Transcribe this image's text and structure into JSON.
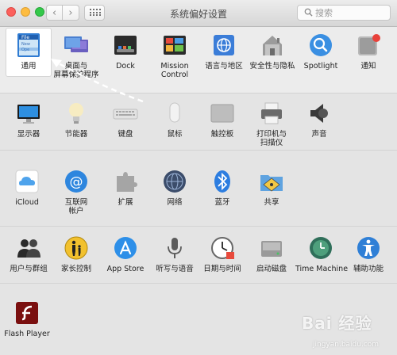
{
  "window": {
    "title": "系统偏好设置",
    "search_placeholder": "搜索"
  },
  "rows": [
    {
      "items": [
        {
          "label": "通用",
          "icon": "general-icon",
          "selected": true
        },
        {
          "label": "桌面与\n屏幕保护程序",
          "icon": "desktop-screensaver-icon"
        },
        {
          "label": "Dock",
          "icon": "dock-icon"
        },
        {
          "label": "Mission\nControl",
          "icon": "mission-control-icon"
        },
        {
          "label": "语言与地区",
          "icon": "language-region-icon"
        },
        {
          "label": "安全性与隐私",
          "icon": "security-privacy-icon"
        },
        {
          "label": "Spotlight",
          "icon": "spotlight-icon"
        },
        {
          "label": "通知",
          "icon": "notifications-icon"
        }
      ]
    },
    {
      "items": [
        {
          "label": "显示器",
          "icon": "displays-icon"
        },
        {
          "label": "节能器",
          "icon": "energy-saver-icon"
        },
        {
          "label": "键盘",
          "icon": "keyboard-icon"
        },
        {
          "label": "鼠标",
          "icon": "mouse-icon"
        },
        {
          "label": "触控板",
          "icon": "trackpad-icon"
        },
        {
          "label": "打印机与\n扫描仪",
          "icon": "printers-scanners-icon"
        },
        {
          "label": "声音",
          "icon": "sound-icon"
        }
      ]
    },
    {
      "items": [
        {
          "label": "iCloud",
          "icon": "icloud-icon"
        },
        {
          "label": "互联网\n帐户",
          "icon": "internet-accounts-icon"
        },
        {
          "label": "扩展",
          "icon": "extensions-icon"
        },
        {
          "label": "网络",
          "icon": "network-icon"
        },
        {
          "label": "蓝牙",
          "icon": "bluetooth-icon"
        },
        {
          "label": "共享",
          "icon": "sharing-icon"
        }
      ]
    },
    {
      "items": [
        {
          "label": "用户与群组",
          "icon": "users-groups-icon"
        },
        {
          "label": "家长控制",
          "icon": "parental-controls-icon"
        },
        {
          "label": "App Store",
          "icon": "app-store-icon"
        },
        {
          "label": "听写与语音",
          "icon": "dictation-speech-icon"
        },
        {
          "label": "日期与时间",
          "icon": "date-time-icon"
        },
        {
          "label": "启动磁盘",
          "icon": "startup-disk-icon"
        },
        {
          "label": "Time Machine",
          "icon": "time-machine-icon"
        },
        {
          "label": "辅助功能",
          "icon": "accessibility-icon"
        }
      ]
    },
    {
      "items": [
        {
          "label": "Flash Player",
          "icon": "flash-player-icon"
        }
      ]
    }
  ],
  "watermark": {
    "main": "Bai 经验",
    "sub": "jingyan.baidu.com"
  }
}
